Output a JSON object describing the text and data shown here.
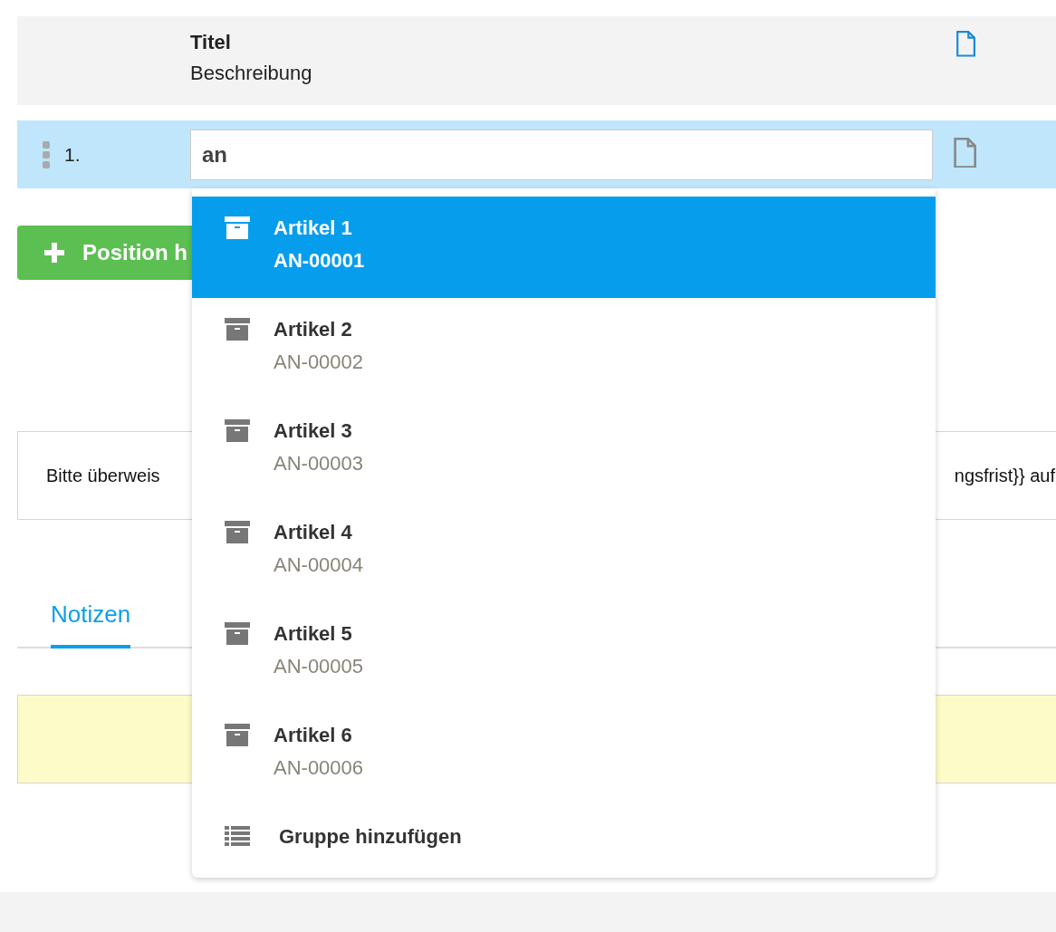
{
  "header": {
    "title": "Titel",
    "description": "Beschreibung"
  },
  "rows": [
    {
      "number": "1.",
      "value": "an",
      "selected": true
    }
  ],
  "dropdown": {
    "items": [
      {
        "kind": "article",
        "name": "Artikel 1",
        "code": "AN-00001",
        "selected": true
      },
      {
        "kind": "article",
        "name": "Artikel 2",
        "code": "AN-00002",
        "selected": false
      },
      {
        "kind": "article",
        "name": "Artikel 3",
        "code": "AN-00003",
        "selected": false
      },
      {
        "kind": "article",
        "name": "Artikel 4",
        "code": "AN-00004",
        "selected": false
      },
      {
        "kind": "article",
        "name": "Artikel 5",
        "code": "AN-00005",
        "selected": false
      },
      {
        "kind": "article",
        "name": "Artikel 6",
        "code": "AN-00006",
        "selected": false
      },
      {
        "kind": "group",
        "name": "Gruppe hinzufügen",
        "selected": false
      }
    ]
  },
  "add_button": "Position h",
  "text_block": {
    "left": "Bitte überweis",
    "right": "ngsfrist}} auf"
  },
  "tabs": [
    {
      "label": "Notizen",
      "selected": true
    }
  ]
}
